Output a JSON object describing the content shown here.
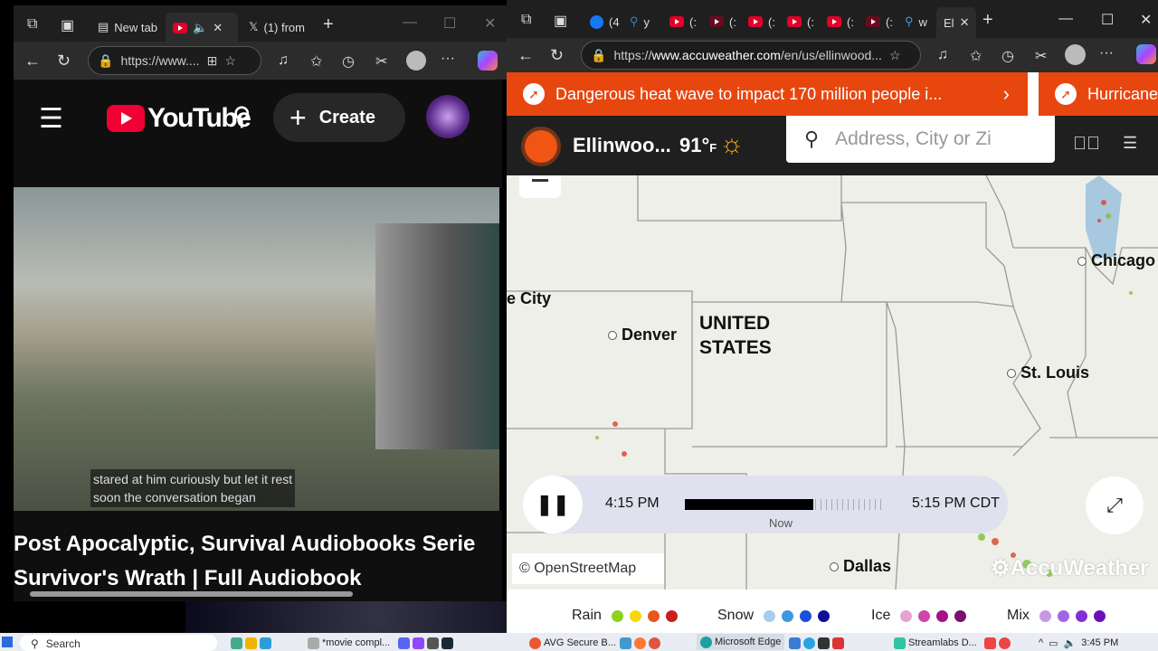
{
  "left_browser": {
    "tabs": [
      {
        "label": "New tab"
      },
      {
        "label": "",
        "active": true,
        "audio": true
      },
      {
        "label": "(1) from"
      }
    ],
    "url": "https://www....",
    "youtube": {
      "logo_text": "YouTube",
      "create_label": "Create",
      "captions": [
        "stared at him curiously but let it rest",
        "soon the conversation began"
      ],
      "video_title_line1": "Post Apocalyptic, Survival Audiobooks Serie",
      "video_title_line2": "Survivor's Wrath | Full Audiobook"
    }
  },
  "right_browser": {
    "tab_labels": [
      "(4",
      "y",
      "(:",
      "(:",
      "(:",
      "(:",
      "(:",
      "(:",
      "w",
      "El"
    ],
    "url_prefix": "https://",
    "url_host": "www.accuweather.com",
    "url_path": "/en/us/ellinwood...",
    "banner": {
      "text": "Dangerous heat wave to impact 170 million people i...",
      "next_text": "Hurricane",
      "color": "#e8460f"
    },
    "header": {
      "location": "Ellinwoo...",
      "temp": "91°",
      "unit": "F",
      "search_placeholder": "Address, City or Zi"
    },
    "map": {
      "cities": [
        "Denver",
        "Chicago",
        "St. Louis",
        "Dallas"
      ],
      "partial_city": "e City",
      "country_line1": "UNITED",
      "country_line2": "STATES",
      "attribution": "© OpenStreetMap",
      "watermark": "AccuWeather"
    },
    "timeline": {
      "start": "4:15 PM",
      "end": "5:15 PM CDT",
      "now_label": "Now",
      "progress_percent": 64
    },
    "legend": [
      {
        "label": "Rain",
        "colors": [
          "#8fd11f",
          "#f5d90a",
          "#e8561e",
          "#cc1d1d"
        ]
      },
      {
        "label": "Snow",
        "colors": [
          "#a8cdf0",
          "#3d97dd",
          "#1d4fdd",
          "#0b0f99"
        ]
      },
      {
        "label": "Ice",
        "colors": [
          "#e6a2cf",
          "#cf45aa",
          "#a8108a",
          "#7a0f6e"
        ]
      },
      {
        "label": "Mix",
        "colors": [
          "#c49ae6",
          "#a565e2",
          "#8130d8",
          "#6a10b8"
        ]
      }
    ]
  },
  "taskbar": {
    "search": "Search",
    "items": [
      "*movie compl...",
      "AVG Secure B...",
      "Microsoft Edge",
      "Streamlabs D..."
    ],
    "time": "3:45 PM"
  }
}
